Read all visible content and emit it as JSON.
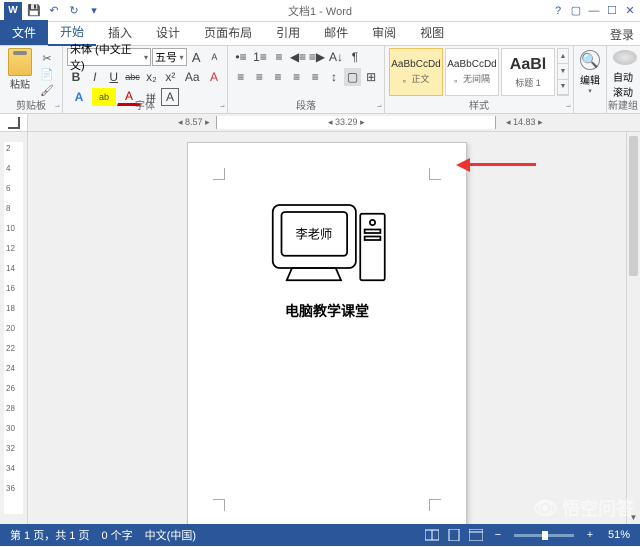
{
  "title": "文档1 - Word",
  "qat": {
    "save": "💾",
    "undo": "↶",
    "redo": "↻",
    "more": "▾"
  },
  "winhelp": {
    "help": "?",
    "ribbon": "▢",
    "min": "—",
    "max": "☐",
    "close": "✕"
  },
  "login": "登录",
  "tabs": {
    "file": "文件",
    "home": "开始",
    "insert": "插入",
    "design": "设计",
    "layout": "页面布局",
    "references": "引用",
    "mailings": "邮件",
    "review": "审阅",
    "view": "视图"
  },
  "clipboard": {
    "paste": "粘贴",
    "label": "剪贴板"
  },
  "font": {
    "family": "宋体 (中文正文)",
    "size": "五号",
    "grow": "A",
    "shrink": "A",
    "changecase": "Aa",
    "clear": "A",
    "bold": "B",
    "italic": "I",
    "underline": "U",
    "strike": "abc",
    "sub": "x₂",
    "sup": "x²",
    "effects": "A",
    "highlight": "ab",
    "color": "A",
    "phonetic": "拼",
    "border": "A",
    "label": "字体"
  },
  "para": {
    "bullets": "≡",
    "numbering": "≡",
    "multilevel": "≡",
    "decrease": "◀",
    "increase": "▶",
    "sort": "A↓",
    "showmarks": "¶",
    "alignL": "≡",
    "alignC": "≡",
    "alignR": "≡",
    "alignJ": "≡",
    "alignD": "≡",
    "linespace": "↕",
    "shading": "▢",
    "borders": "⊞",
    "label": "段落"
  },
  "styles": {
    "s1": {
      "prev": "AaBbCcDd",
      "name": "。正文"
    },
    "s2": {
      "prev": "AaBbCcDd",
      "name": "。无间隔"
    },
    "s3": {
      "prev": "AaBl",
      "name": "标题 1"
    },
    "label": "样式"
  },
  "edit": {
    "label": "编辑"
  },
  "newgroup": {
    "auto": "自动滚动",
    "label": "新建组"
  },
  "ruler": {
    "left": "8.57",
    "center": "33.29",
    "right": "14.83"
  },
  "vruler_ticks": [
    "2",
    "4",
    "6",
    "8",
    "10",
    "12",
    "14",
    "16",
    "18",
    "20",
    "22",
    "24",
    "26",
    "28",
    "30",
    "32",
    "34",
    "36"
  ],
  "document": {
    "monitor_text": "李老师",
    "caption": "电脑教学课堂"
  },
  "status": {
    "page": "第 1 页，共 1 页",
    "words": "0 个字",
    "lang": "中文(中国)",
    "zoom": "51%"
  },
  "watermark": "悟空问答"
}
